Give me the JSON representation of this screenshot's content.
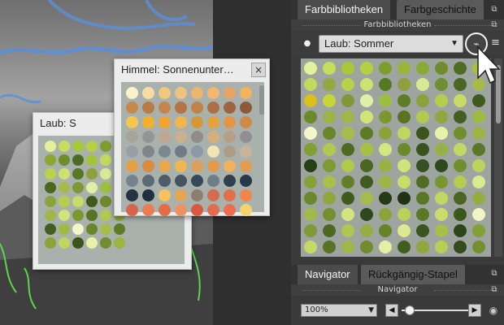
{
  "windows": {
    "laub": {
      "title": "Laub: S"
    },
    "himmel": {
      "title": "Himmel: Sonnenunter…",
      "close_label": "×"
    }
  },
  "panel": {
    "top_tabs": [
      "Farbbibliotheken",
      "Farbgeschichte"
    ],
    "section_title": "Farbbibliotheken",
    "library_selected": "Laub: Sommer",
    "library_dropdown_arrow": "▼",
    "bottom_tabs": [
      "Navigator",
      "Rückgängig-Stapel"
    ],
    "navigator_title": "Navigator",
    "zoom_value": "100%",
    "zoom_arrow": "▼",
    "nav_prev": "◀",
    "nav_next": "▶"
  },
  "icons": {
    "link": "link-icon",
    "menu": "menu-icon",
    "user": "user-icon",
    "eye": "eye-icon",
    "float": "float-icon",
    "close": "close-icon"
  },
  "colors": {
    "panel_bg": "#3a3a3a",
    "swatch_bg": "#9ea49f",
    "window_bg": "#ececec"
  },
  "swatches": {
    "laub_window": [
      "#e4f09a",
      "#c7dd5c",
      "#a8c83a",
      "#b6cf43",
      "#7e9d2f",
      "#9ab63a",
      "#8aa932",
      "#6e8c2b",
      "#4d6d22",
      "#a3c33c",
      "#c4d85d",
      "#94a743",
      "#b9d24a",
      "#cfe171",
      "#557a23",
      "#8f9f3c",
      "#d9e894",
      "#6e8f2f",
      "#4b6620",
      "#a7b94b",
      "#7f9736",
      "#e1eea7",
      "#9cbf40",
      "#5f7c26",
      "#8aa23a",
      "#b7cd4e",
      "#c8db69",
      "#3f5a1d",
      "#6d8a2b",
      "#9bb347",
      "#a2b548",
      "#d2e37a",
      "#7d962f",
      "#587423",
      "#b1c851",
      "#90a83b",
      "#435f1f",
      "#9fba43",
      "#f2f6c8",
      "#6a862a",
      "#a7bd4a",
      "#5e7a25",
      "#8ba23a",
      "#c1d661",
      "#3b541b",
      "#e7f1a8",
      "#728d2d",
      "#9db443"
    ],
    "himmel_window": [
      "#fbf3c9",
      "#f6dca0",
      "#f1c97d",
      "#efc281",
      "#ebb56b",
      "#f3b870",
      "#e7a563",
      "#f2b35c",
      "#c38a4a",
      "#b97a43",
      "#c4864c",
      "#b57347",
      "#c08248",
      "#ad6f43",
      "#9e6440",
      "#8a5a3a",
      "#f4c84c",
      "#f2b12c",
      "#f2a433",
      "#f0b64c",
      "#d6973b",
      "#e6a13f",
      "#e49442",
      "#cf8a48",
      "#a9a49b",
      "#979495",
      "#bfa790",
      "#c9b08e",
      "#908c88",
      "#d4b17c",
      "#b69f86",
      "#8f8f93",
      "#9a9fa6",
      "#80858d",
      "#7d8791",
      "#6f7c86",
      "#8c98a3",
      "#f2e4b3",
      "#ae9c88",
      "#c8b59a",
      "#e59f45",
      "#d98b3e",
      "#e9a84a",
      "#f0b650",
      "#dca05b",
      "#e39a4c",
      "#f0b15f",
      "#e49c50",
      "#76838c",
      "#5c6a75",
      "#4c5c68",
      "#445360",
      "#35495a",
      "#6e7d87",
      "#2f3f4c",
      "#25394a",
      "#253441",
      "#1f3140",
      "#f4c35d",
      "#e6a64f",
      "#8c7f72",
      "#d66b4e",
      "#e16f4a",
      "#f0864a",
      "#d9634a",
      "#ea7c54",
      "#e56c42",
      "#ef9065",
      "#d8593d",
      "#e46b4f",
      "#f06c50",
      "#f5d36c"
    ],
    "panel": [
      "#e4f09a",
      "#c7dd5c",
      "#a8c83a",
      "#b6cf43",
      "#7e9d2f",
      "#9ab63a",
      "#8aa932",
      "#6e8c2b",
      "#4d6d22",
      "#a3c33c",
      "#c4d85d",
      "#94a743",
      "#b9d24a",
      "#cfe171",
      "#557a23",
      "#8f9f3c",
      "#d9e894",
      "#6e8f2f",
      "#4b6620",
      "#a7b94b",
      "#d9c11d",
      "#c7d636",
      "#7f9736",
      "#e1eea7",
      "#9cbf40",
      "#5f7c26",
      "#8aa23a",
      "#b7cd4e",
      "#c8db69",
      "#3f5a1d",
      "#6d8a2b",
      "#9bb347",
      "#a2b548",
      "#d2e37a",
      "#7d962f",
      "#587423",
      "#b1c851",
      "#90a83b",
      "#435f1f",
      "#9fba43",
      "#f2f6c8",
      "#6a862a",
      "#a7bd4a",
      "#5e7a25",
      "#8ba23a",
      "#c1d661",
      "#3b541b",
      "#e7f1a8",
      "#728d2d",
      "#9db443",
      "#829f33",
      "#b3c852",
      "#4e6b21",
      "#a6c044",
      "#d6e680",
      "#6b8a2c",
      "#3a5220",
      "#98b145",
      "#c3d864",
      "#5a7626",
      "#273f16",
      "#7e9a33",
      "#aecb4a",
      "#4a6621",
      "#96b240",
      "#d0e27a",
      "#355022",
      "#2e4a1d",
      "#6f8e2d",
      "#bdd35b",
      "#85a238",
      "#a9c04b",
      "#637f28",
      "#3f5b1e",
      "#9bb644",
      "#c8dc69",
      "#516d24",
      "#7a952f",
      "#b5cc50",
      "#dbe990",
      "#6b872b",
      "#8ea73d",
      "#3e5a1e",
      "#a5bc48",
      "#243c15",
      "#1f3312",
      "#587725",
      "#c2d762",
      "#4a6523",
      "#93ad40",
      "#a0b948",
      "#748f2f",
      "#d4e57f",
      "#2f481b",
      "#8aa439",
      "#bbd057",
      "#5b7827",
      "#c9dd6b",
      "#3b561d",
      "#f0f5c4",
      "#7e9935",
      "#4c6822",
      "#b0c64e",
      "#95ae41",
      "#668329",
      "#dce98f",
      "#3a551e",
      "#a8bf4c",
      "#2c4519",
      "#81a036",
      "#c5d964",
      "#577325",
      "#9fb746",
      "#6f8b2d",
      "#e4eea4",
      "#425e1f",
      "#8ea83c",
      "#b9ce55",
      "#324c1b",
      "#758f30"
    ]
  }
}
